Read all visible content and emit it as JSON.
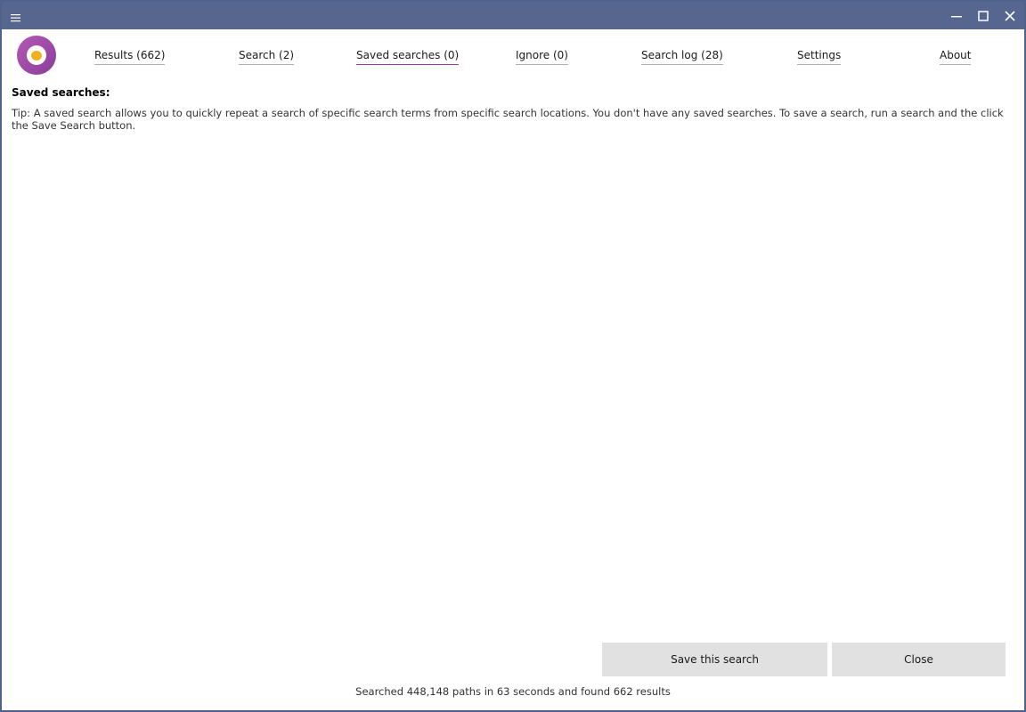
{
  "window": {
    "menu_icon": "hamburger-menu-icon",
    "controls": [
      "minimize-icon",
      "maximize-icon",
      "close-icon"
    ]
  },
  "logo": {
    "icon": "app-logo"
  },
  "tabs": [
    {
      "label": "Results (662)",
      "active": false
    },
    {
      "label": "Search (2)",
      "active": false
    },
    {
      "label": "Saved searches (0)",
      "active": true
    },
    {
      "label": "Ignore (0)",
      "active": false
    },
    {
      "label": "Search log (28)",
      "active": false
    },
    {
      "label": "Settings",
      "active": false
    },
    {
      "label": "About",
      "active": false
    }
  ],
  "main": {
    "title": "Saved searches:",
    "tip": "Tip: A saved search allows you to quickly repeat a search of specific search terms from specific search locations. You don't have any saved searches. To save a search, run a search and the click the Save Search button."
  },
  "buttons": {
    "save_label": "Save this search",
    "close_label": "Close"
  },
  "status": {
    "text": "Searched 448,148 paths in 63 seconds and found 662 results"
  },
  "colors": {
    "titlebar": "#56668f",
    "accent": "#9c3aa0",
    "button": "#e1e1e1"
  }
}
